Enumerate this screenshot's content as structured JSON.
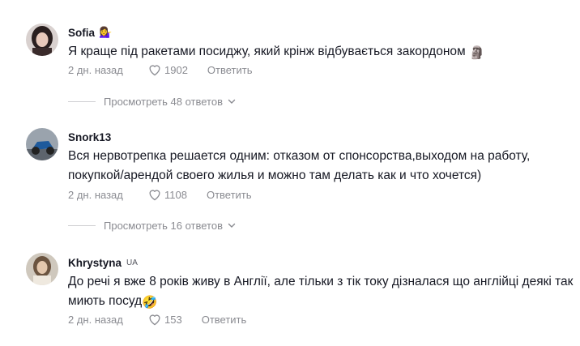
{
  "comments": [
    {
      "username": "Sofia",
      "badge": "",
      "username_emoji": "💁‍♀️",
      "text": "Я краще під ракетами посиджу, який крінж відбувається закордоном",
      "text_emoji": "🗿",
      "date": "2 дн. назад",
      "likes": "1902",
      "reply_label": "Ответить",
      "replies_label": "Просмотреть 48 ответов"
    },
    {
      "username": "Snork13",
      "badge": "",
      "username_emoji": "",
      "text": "Вся нервотрепка решается одним: отказом от спонсорства,выходом на работу, покупкой/арендой своего жилья и можно там делать как и что хочется)",
      "text_emoji": "",
      "date": "2 дн. назад",
      "likes": "1108",
      "reply_label": "Ответить",
      "replies_label": "Просмотреть 16 ответов"
    },
    {
      "username": "Khrystyna",
      "badge": "UA",
      "username_emoji": "",
      "text": "До речі я вже 8 років живу в Англії, але тільки з тік току дізналася що англійці деякі так миють посуд",
      "text_emoji": "🤣",
      "date": "2 дн. назад",
      "likes": "153",
      "reply_label": "Ответить",
      "replies_label": ""
    }
  ],
  "colors": {
    "text": "#161823",
    "secondary": "#8a8b91",
    "divider": "#cfcfd2"
  },
  "icons": {
    "like": "heart-icon",
    "expand": "chevron-down-icon"
  }
}
